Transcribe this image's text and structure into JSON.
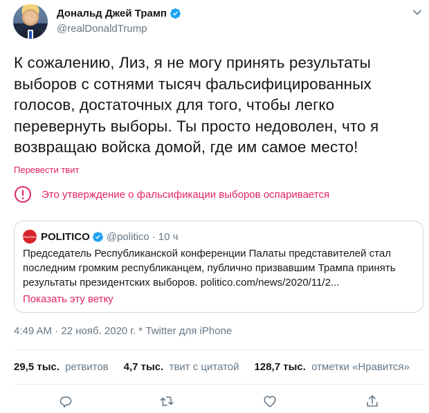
{
  "author": {
    "name": "Дональд Джей Трамп",
    "handle": "@realDonaldTrump"
  },
  "tweet": {
    "text": "К сожалению, Лиз, я не могу принять результаты выборов с сотнями тысяч фальсифицированных голосов, достаточных для того, чтобы легко перевернуть выборы. Ты просто недоволен, что я возвращаю войска домой, где им самое место!",
    "translate_label": "Перевести твит",
    "notice": "Это утверждение о фальсификации выборов оспаривается"
  },
  "quoted": {
    "name": "POLITICO",
    "logo_text": "POLITICO",
    "handle": "@politico",
    "separator": "·",
    "time": "10 ч",
    "text": "Председатель Республиканской конференции Палаты представителей стал последним громким республиканцем, публично призвавшим Трампа принять результаты президентских выборов. politico.com/news/2020/11/2...",
    "show_thread": "Показать эту ветку"
  },
  "meta": "4:49 AM · 22 нояб. 2020 г. * Twitter для iPhone",
  "stats": [
    {
      "count": "29,5 тыс.",
      "label": "ретвитов"
    },
    {
      "count": "4,7 тыс.",
      "label": "твит с цитатой"
    },
    {
      "count": "128,7 тыс.",
      "label": "отметки «Нравится»"
    }
  ],
  "colors": {
    "accent": "#e0245e",
    "verified": "#1da1f2",
    "secondary_text": "#657786",
    "border": "#ccd6dd"
  },
  "icons": [
    "verified-badge-icon",
    "chevron-down-icon",
    "warning-circle-icon",
    "reply-icon",
    "retweet-icon",
    "like-icon",
    "share-icon"
  ]
}
